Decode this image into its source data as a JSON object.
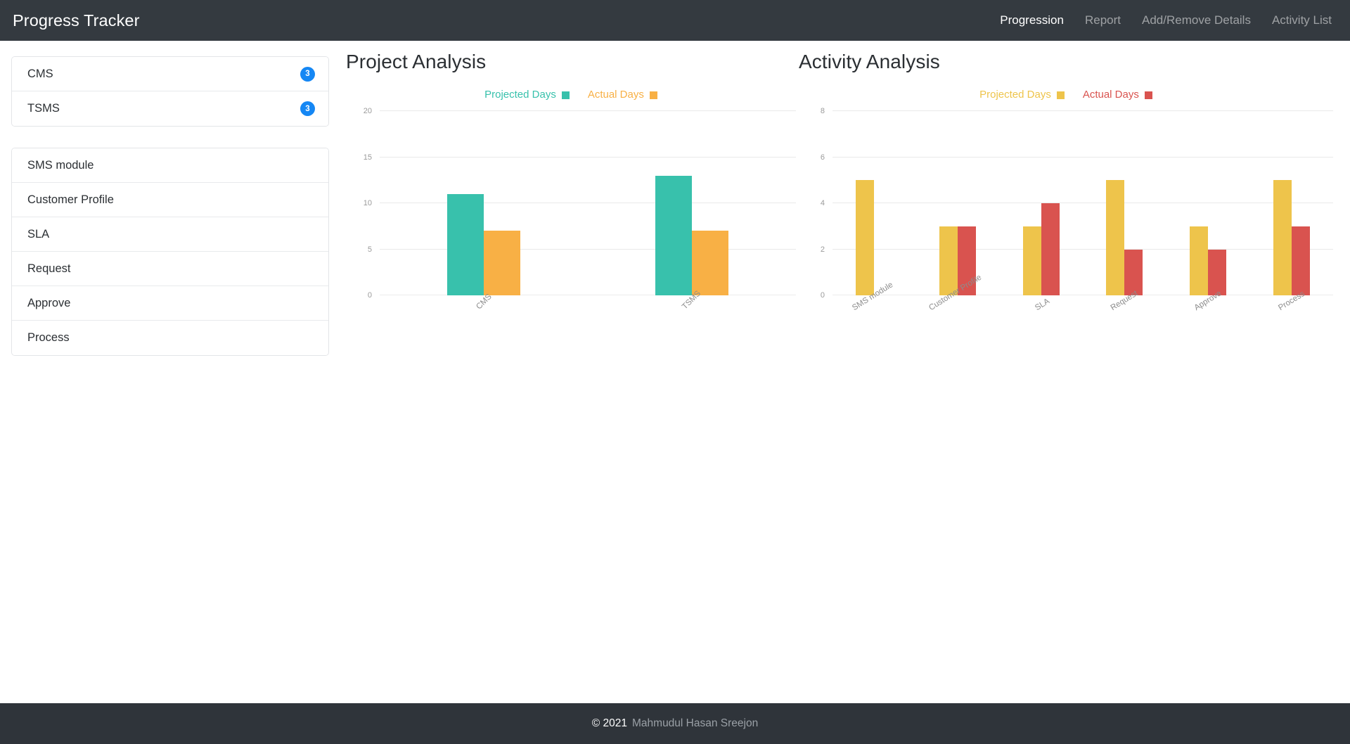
{
  "navbar": {
    "brand": "Progress Tracker",
    "links": [
      {
        "label": "Progression",
        "active": true
      },
      {
        "label": "Report",
        "active": false
      },
      {
        "label": "Add/Remove Details",
        "active": false
      },
      {
        "label": "Activity List",
        "active": false
      }
    ]
  },
  "sidebar": {
    "projects": [
      {
        "label": "CMS",
        "badge": "3"
      },
      {
        "label": "TSMS",
        "badge": "3"
      }
    ],
    "activities": [
      {
        "label": "SMS module"
      },
      {
        "label": "Customer Profile"
      },
      {
        "label": "SLA"
      },
      {
        "label": "Request"
      },
      {
        "label": "Approve"
      },
      {
        "label": "Process"
      }
    ]
  },
  "colors": {
    "navbar_bg": "#343a40",
    "footer_bg": "#2f343a",
    "badge": "#1587f4",
    "project_projected": "#38c1ac",
    "project_actual": "#f8b045",
    "activity_projected": "#eec44b",
    "activity_actual": "#d9534f"
  },
  "footer": {
    "copyright": "© 2021",
    "author": "Mahmudul Hasan Sreejon"
  },
  "chart_data": [
    {
      "type": "bar",
      "title": "Project Analysis",
      "xlabel": "",
      "ylabel": "",
      "ylim": [
        0,
        20
      ],
      "yticks": [
        0,
        5,
        10,
        15,
        20
      ],
      "grid": true,
      "legend_position": "top-center",
      "categories": [
        "CMS",
        "TSMS"
      ],
      "series": [
        {
          "name": "Projected Days",
          "color": "#38c1ac",
          "values": [
            11,
            13
          ]
        },
        {
          "name": "Actual Days",
          "color": "#f8b045",
          "values": [
            7,
            7
          ]
        }
      ]
    },
    {
      "type": "bar",
      "title": "Activity Analysis",
      "xlabel": "",
      "ylabel": "",
      "ylim": [
        0,
        8
      ],
      "yticks": [
        0,
        2,
        4,
        6,
        8
      ],
      "grid": true,
      "legend_position": "top-center",
      "categories": [
        "SMS module",
        "Customer Profile",
        "SLA",
        "Request",
        "Approve",
        "Process"
      ],
      "series": [
        {
          "name": "Projected Days",
          "color": "#eec44b",
          "values": [
            5,
            3,
            3,
            5,
            3,
            5
          ]
        },
        {
          "name": "Actual Days",
          "color": "#d9534f",
          "values": [
            0,
            3,
            4,
            2,
            2,
            3
          ]
        }
      ]
    }
  ]
}
